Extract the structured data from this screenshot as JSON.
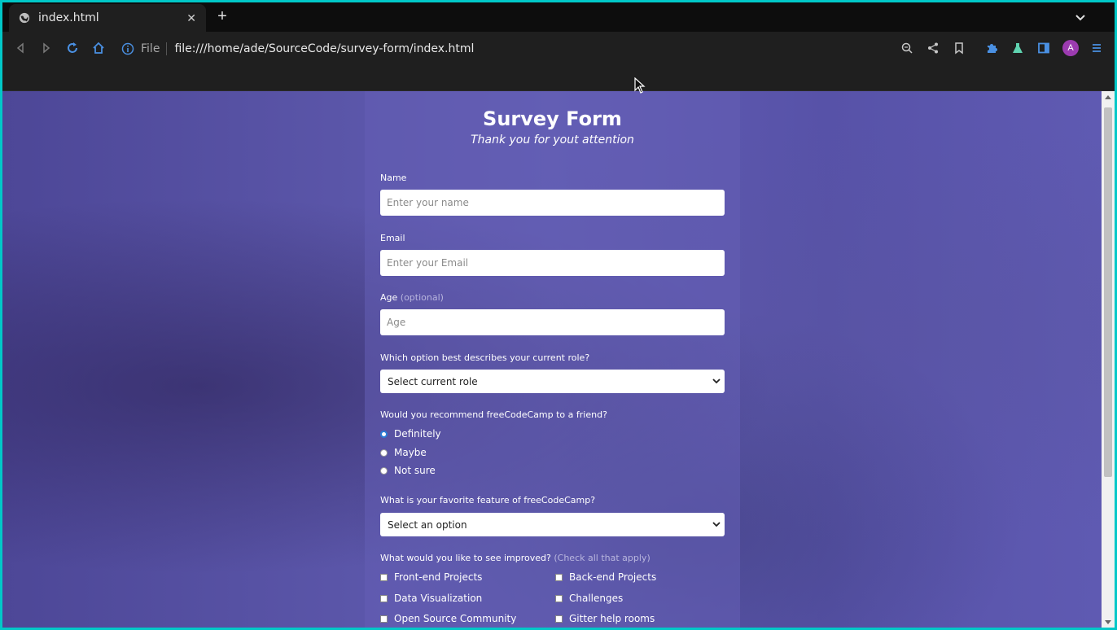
{
  "browser": {
    "tab_title": "index.html",
    "new_tab_label": "+",
    "address_scheme_label": "File",
    "url": "file:///home/ade/SourceCode/survey-form/index.html",
    "avatar_letter": "A",
    "accent_color": "#4a90e2"
  },
  "form": {
    "title": "Survey Form",
    "subtitle": "Thank you for yout attention",
    "name_label": "Name",
    "name_placeholder": "Enter your name",
    "email_label": "Email",
    "email_placeholder": "Enter your Email",
    "age_label": "Age",
    "age_optional": "(optional)",
    "age_placeholder": "Age",
    "role_question": "Which option best describes your current role?",
    "role_selected": "Select current role",
    "recommend_question": "Would you recommend freeCodeCamp to a friend?",
    "recommend_options": [
      "Definitely",
      "Maybe",
      "Not sure"
    ],
    "recommend_selected": "Definitely",
    "feature_question": "What is your favorite feature of freeCodeCamp?",
    "feature_selected": "Select an option",
    "improve_question": "What would you like to see improved?",
    "improve_hint": "(Check all that apply)",
    "improve_options": [
      "Front-end Projects",
      "Back-end Projects",
      "Data Visualization",
      "Challenges",
      "Open Source Community",
      "Gitter help rooms"
    ]
  }
}
